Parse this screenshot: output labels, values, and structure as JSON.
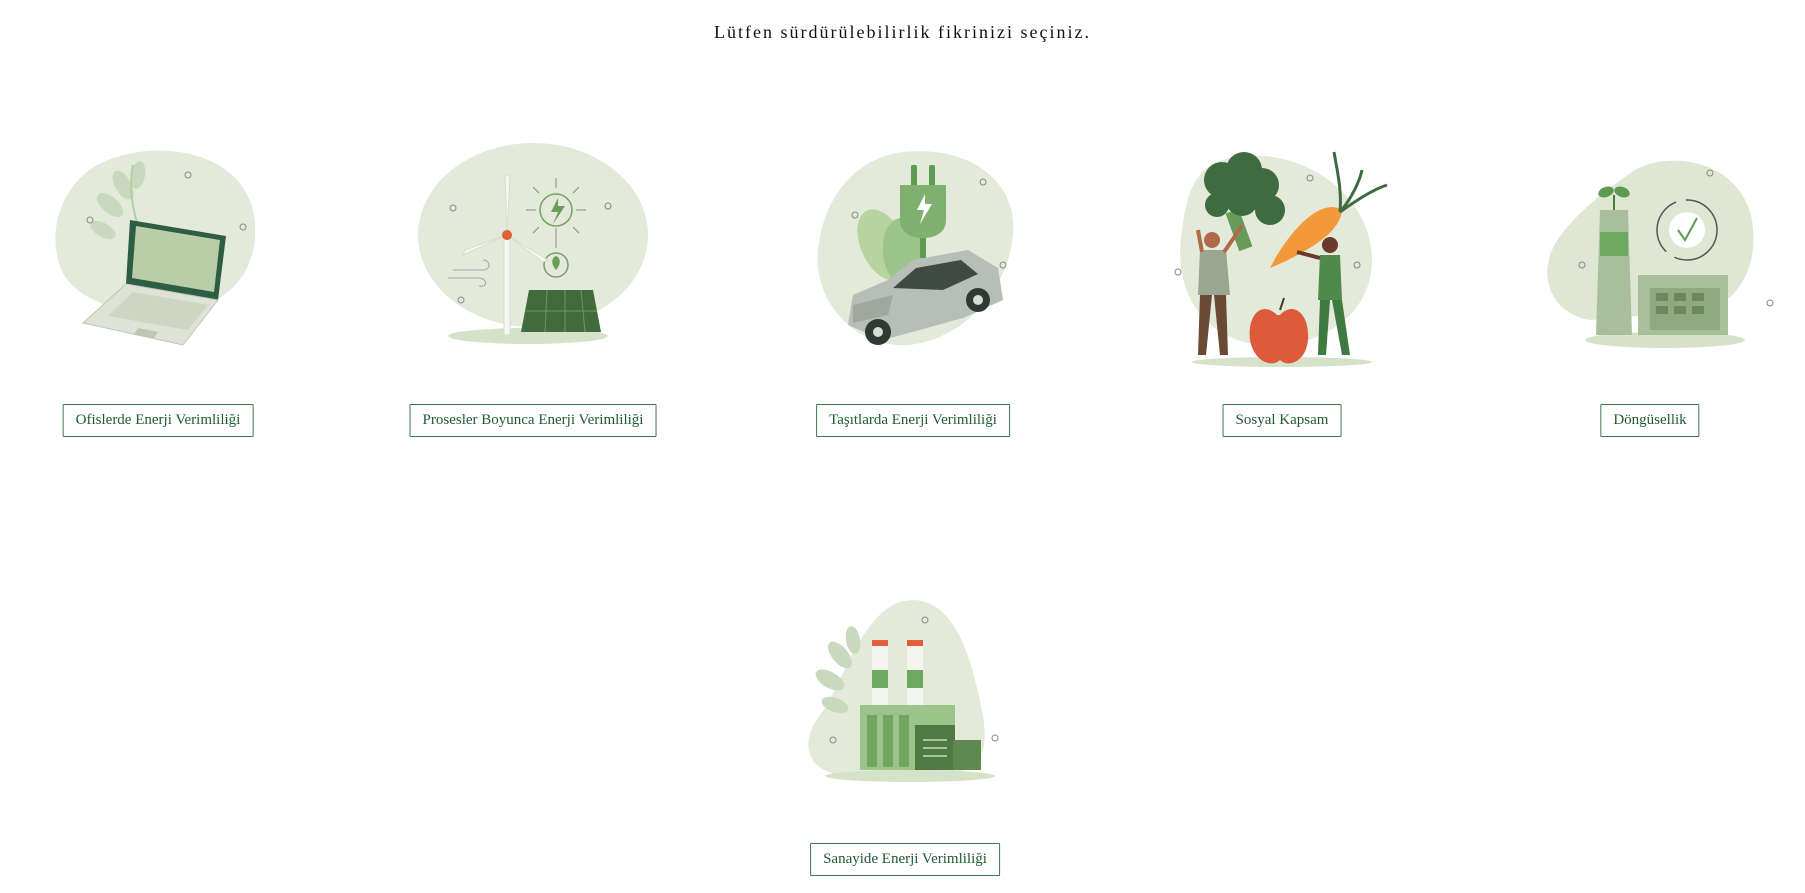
{
  "page": {
    "title": "Lütfen sürdürülebilirlik fikrinizi seçiniz."
  },
  "cards": [
    {
      "label": "Ofislerde Enerji Verimliliği",
      "icon": "laptop-icon"
    },
    {
      "label": "Prosesler Boyunca Enerji Verimliliği",
      "icon": "wind-turbine-solar-icon"
    },
    {
      "label": "Taşıtlarda Enerji Verimliliği",
      "icon": "electric-car-icon"
    },
    {
      "label": "Sosyal Kapsam",
      "icon": "people-vegetables-icon"
    },
    {
      "label": "Döngüsellik",
      "icon": "circular-factory-icon"
    },
    {
      "label": "Sanayide Enerji Verimliliği",
      "icon": "factory-icon"
    }
  ],
  "colors": {
    "blob": "#e3ead9",
    "green_dark": "#2f5f3f",
    "green_mid": "#5e9a52",
    "green_light": "#9cc48a",
    "accent_orange": "#e0603a",
    "button_text": "#1f5a33",
    "button_border": "#3a7a4d"
  }
}
